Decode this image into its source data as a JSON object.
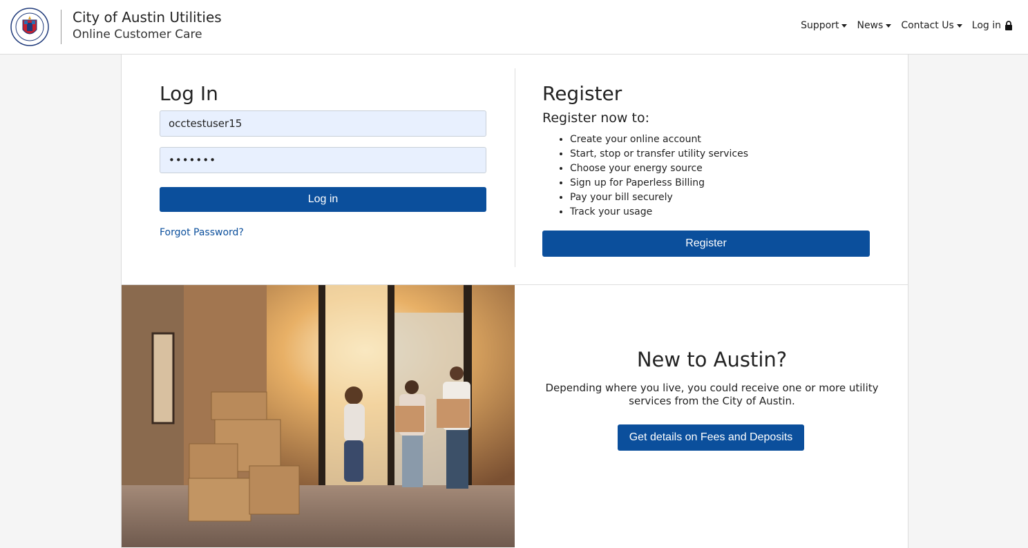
{
  "header": {
    "brand_title": "City of Austin Utilities",
    "brand_subtitle": "Online Customer Care",
    "nav": [
      {
        "label": "Support",
        "dropdown": true
      },
      {
        "label": "News",
        "dropdown": true
      },
      {
        "label": "Contact Us",
        "dropdown": true
      },
      {
        "label": "Log in",
        "icon": "lock-icon"
      }
    ]
  },
  "login": {
    "title": "Log In",
    "username_value": "occtestuser15",
    "password_value": "•••••••",
    "button_label": "Log in",
    "forgot_label": "Forgot Password?"
  },
  "register": {
    "title": "Register",
    "subtitle": "Register now to:",
    "items": [
      "Create your online account",
      "Start, stop or transfer utility services",
      "Choose your energy source",
      "Sign up for Paperless Billing",
      "Pay your bill securely",
      "Track your usage"
    ],
    "button_label": "Register"
  },
  "new_to_austin": {
    "title": "New to Austin?",
    "text": "Depending where you live, you could receive one or more utility services from the City of Austin.",
    "button_label": "Get details on Fees and Deposits"
  },
  "colors": {
    "primary": "#0b4f9c",
    "input_bg": "#e8f0fe",
    "page_bg": "#f5f5f5"
  }
}
